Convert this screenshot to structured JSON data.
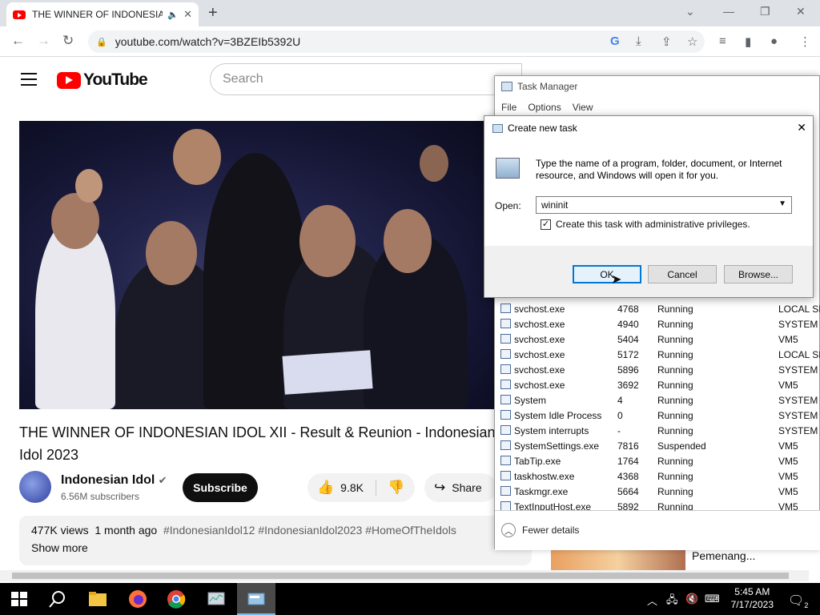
{
  "browser": {
    "tab_title": "THE WINNER OF INDONESIA",
    "url": "youtube.com/watch?v=3BZEIb5392U"
  },
  "youtube": {
    "logo_text": "YouTube",
    "search_placeholder": "Search",
    "video_title": "THE WINNER OF INDONESIAN IDOL XII - Result & Reunion - Indonesian Idol 2023",
    "channel_name": "Indonesian Idol",
    "subscribers": "6.56M subscribers",
    "subscribe_label": "Subscribe",
    "like_count": "9.8K",
    "share_label": "Share",
    "views": "477K views",
    "posted": "1 month ago",
    "tags": "#IndonesianIdol12 #IndonesianIdol2023 #HomeOfTheIdols",
    "show_more": "Show more",
    "suggestion_title": "Pemenang..."
  },
  "task_manager": {
    "title": "Task Manager",
    "menu": [
      "File",
      "Options",
      "View"
    ],
    "processes": [
      {
        "name": "svchost.exe",
        "pid": "4768",
        "status": "Running",
        "user": "LOCAL SE"
      },
      {
        "name": "svchost.exe",
        "pid": "4940",
        "status": "Running",
        "user": "SYSTEM"
      },
      {
        "name": "svchost.exe",
        "pid": "5404",
        "status": "Running",
        "user": "VM5"
      },
      {
        "name": "svchost.exe",
        "pid": "5172",
        "status": "Running",
        "user": "LOCAL SE"
      },
      {
        "name": "svchost.exe",
        "pid": "5896",
        "status": "Running",
        "user": "SYSTEM"
      },
      {
        "name": "svchost.exe",
        "pid": "3692",
        "status": "Running",
        "user": "VM5"
      },
      {
        "name": "System",
        "pid": "4",
        "status": "Running",
        "user": "SYSTEM"
      },
      {
        "name": "System Idle Process",
        "pid": "0",
        "status": "Running",
        "user": "SYSTEM"
      },
      {
        "name": "System interrupts",
        "pid": "-",
        "status": "Running",
        "user": "SYSTEM"
      },
      {
        "name": "SystemSettings.exe",
        "pid": "7816",
        "status": "Suspended",
        "user": "VM5"
      },
      {
        "name": "TabTip.exe",
        "pid": "1764",
        "status": "Running",
        "user": "VM5"
      },
      {
        "name": "taskhostw.exe",
        "pid": "4368",
        "status": "Running",
        "user": "VM5"
      },
      {
        "name": "Taskmgr.exe",
        "pid": "5664",
        "status": "Running",
        "user": "VM5"
      },
      {
        "name": "TextInputHost.exe",
        "pid": "5892",
        "status": "Running",
        "user": "VM5"
      }
    ],
    "fewer_details": "Fewer details"
  },
  "dialog": {
    "title": "Create new task",
    "message": "Type the name of a program, folder, document, or Internet resource, and Windows will open it for you.",
    "open_label": "Open:",
    "open_value": "wininit",
    "admin_label": "Create this task with administrative privileges.",
    "ok": "OK",
    "cancel": "Cancel",
    "browse": "Browse..."
  },
  "taskbar": {
    "time": "5:45 AM",
    "date": "7/17/2023",
    "notifications": "2"
  }
}
